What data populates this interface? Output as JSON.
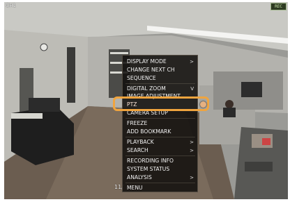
{
  "camera": {
    "channel_label": "CH1",
    "status_badge": "REC",
    "timestamp_partial": "11/"
  },
  "menu": {
    "items": [
      {
        "label": "DISPLAY MODE",
        "arrow": ">"
      },
      {
        "label": "CHANGE NEXT CH",
        "arrow": ""
      },
      {
        "label": "SEQUENCE",
        "arrow": ""
      },
      {
        "label": "DIGITAL ZOOM",
        "arrow": "V"
      },
      {
        "label": "IMAGE ADJUSTMENT",
        "arrow": ""
      },
      {
        "label": "PTZ",
        "arrow": ""
      },
      {
        "label": "CAMERA SETUP",
        "arrow": ""
      },
      {
        "label": "FREEZE",
        "arrow": ""
      },
      {
        "label": "ADD BOOKMARK",
        "arrow": ""
      },
      {
        "label": "PLAYBACK",
        "arrow": ">"
      },
      {
        "label": "SEARCH",
        "arrow": ">"
      },
      {
        "label": "RECORDING INFO",
        "arrow": ""
      },
      {
        "label": "SYSTEM STATUS",
        "arrow": ""
      },
      {
        "label": "ANALYSIS",
        "arrow": ">"
      },
      {
        "label": "MENU",
        "arrow": ""
      }
    ],
    "selected_item": "PTZ",
    "highlight_color": "#f0a43e"
  }
}
